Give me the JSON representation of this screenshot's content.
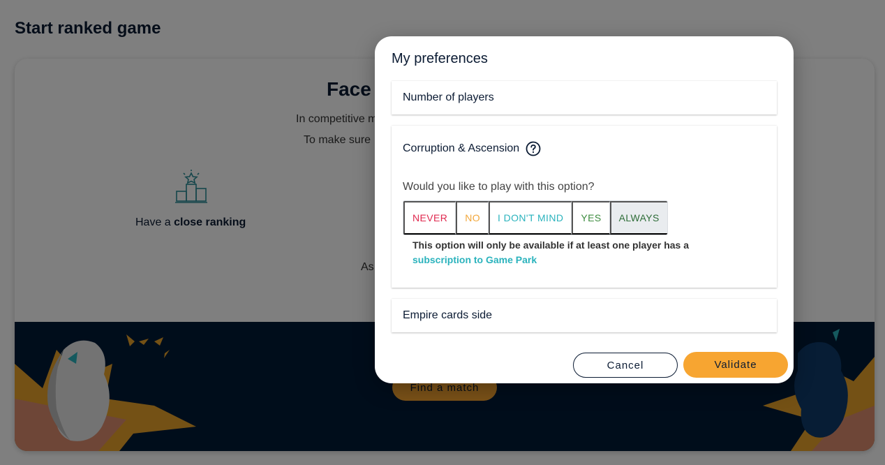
{
  "page": {
    "title": "Start ranked game",
    "card_heading": "Face",
    "card_line1": "In competitive m",
    "card_line2": "To make sure",
    "card_line3": "As",
    "feature_prefix": "Have a ",
    "feature_bold": "close ranking",
    "find_match": "Find a match"
  },
  "modal": {
    "title": "My preferences",
    "panels": [
      {
        "label": "Number of players"
      },
      {
        "label": "Corruption & Ascension"
      },
      {
        "label": "Empire cards side"
      }
    ],
    "question": "Would you like to play with this option?",
    "choices": [
      "NEVER",
      "NO",
      "I DON'T MIND",
      "YES",
      "ALWAYS"
    ],
    "selected_choice": "ALWAYS",
    "note_text": "This option will only be available if at least one player has a",
    "note_link": "subscription to Game Park",
    "cancel": "Cancel",
    "validate": "Validate"
  },
  "colors": {
    "accent": "#f7a531",
    "navy": "#0b1b33",
    "teal": "#2bb3bd",
    "never": "#e0294f",
    "no": "#f2a73b",
    "yes": "#3d8c3f",
    "always": "#2e6d38"
  },
  "icons": [
    "podium-icon",
    "help-circle-icon",
    "meeple-icon"
  ]
}
